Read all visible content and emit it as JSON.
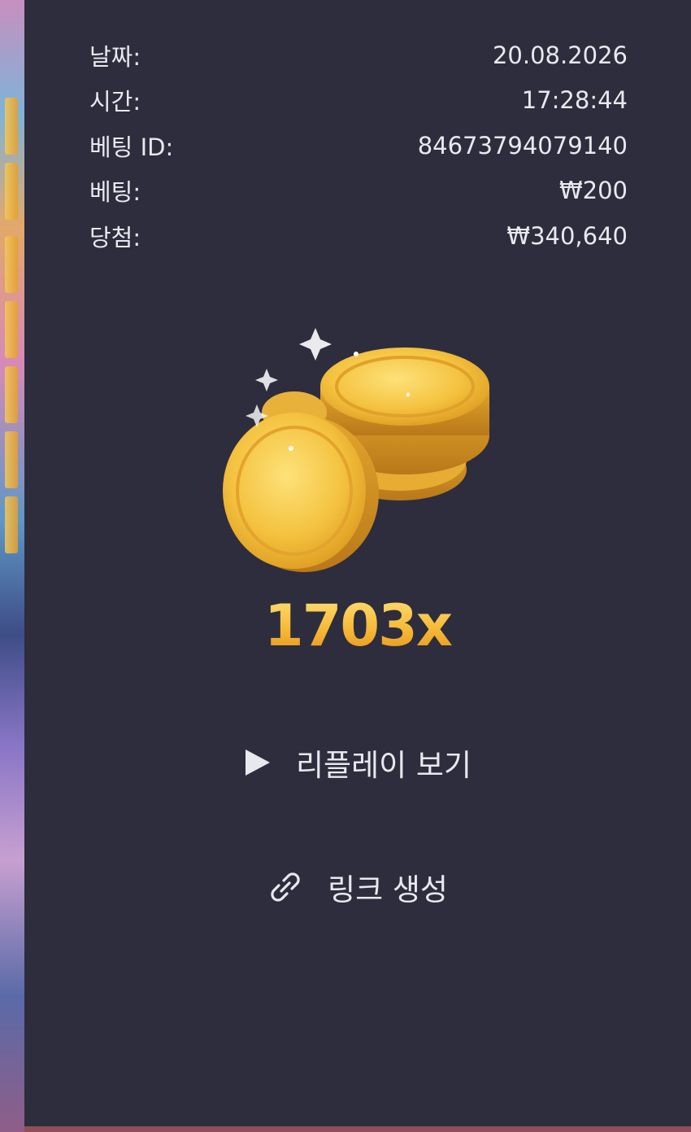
{
  "bet_details": {
    "rows": [
      {
        "label": "날짜:",
        "value": "20.08.2026"
      },
      {
        "label": "시간:",
        "value": "17:28:44"
      },
      {
        "label": "베팅 ID:",
        "value": "84673794079140"
      },
      {
        "label": "베팅:",
        "value": "₩200"
      },
      {
        "label": "당첨:",
        "value": "₩340,640"
      }
    ]
  },
  "win": {
    "multiplier": "1703x",
    "image_icon": "gold-coins-icon"
  },
  "actions": {
    "replay_label": "리플레이 보기",
    "replay_icon": "play-icon",
    "link_label": "링크 생성",
    "link_icon": "link-icon"
  },
  "colors": {
    "panel_background": "#2e2d3d",
    "text": "#e8e8ee",
    "gold": "#f3b33a"
  }
}
